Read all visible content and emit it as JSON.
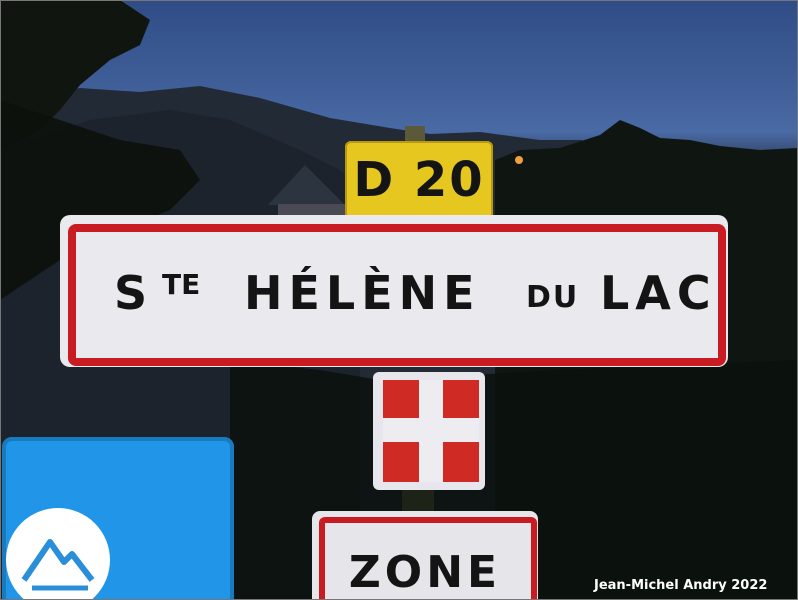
{
  "photo": {
    "description_colors": {
      "sky": "#3f5e9b",
      "sign_red": "#c81c22",
      "sign_yellow": "#e6c71f",
      "sign_white": "#e9e9ee",
      "regional_blue": "#2196e8"
    }
  },
  "road_sign": {
    "label": "D 20"
  },
  "town_sign": {
    "st_S": "S",
    "st_TE": "TE",
    "name_main": "HÉLÈNE",
    "du": "DU",
    "lac": "LAC"
  },
  "flag_sign": {
    "emblem": "savoie-flag"
  },
  "zone_sign": {
    "label": "ZONE"
  },
  "regional_sign": {
    "emblem": "mountain-logo-icon"
  },
  "credit": {
    "text": "Jean-Michel Andry 2022"
  }
}
